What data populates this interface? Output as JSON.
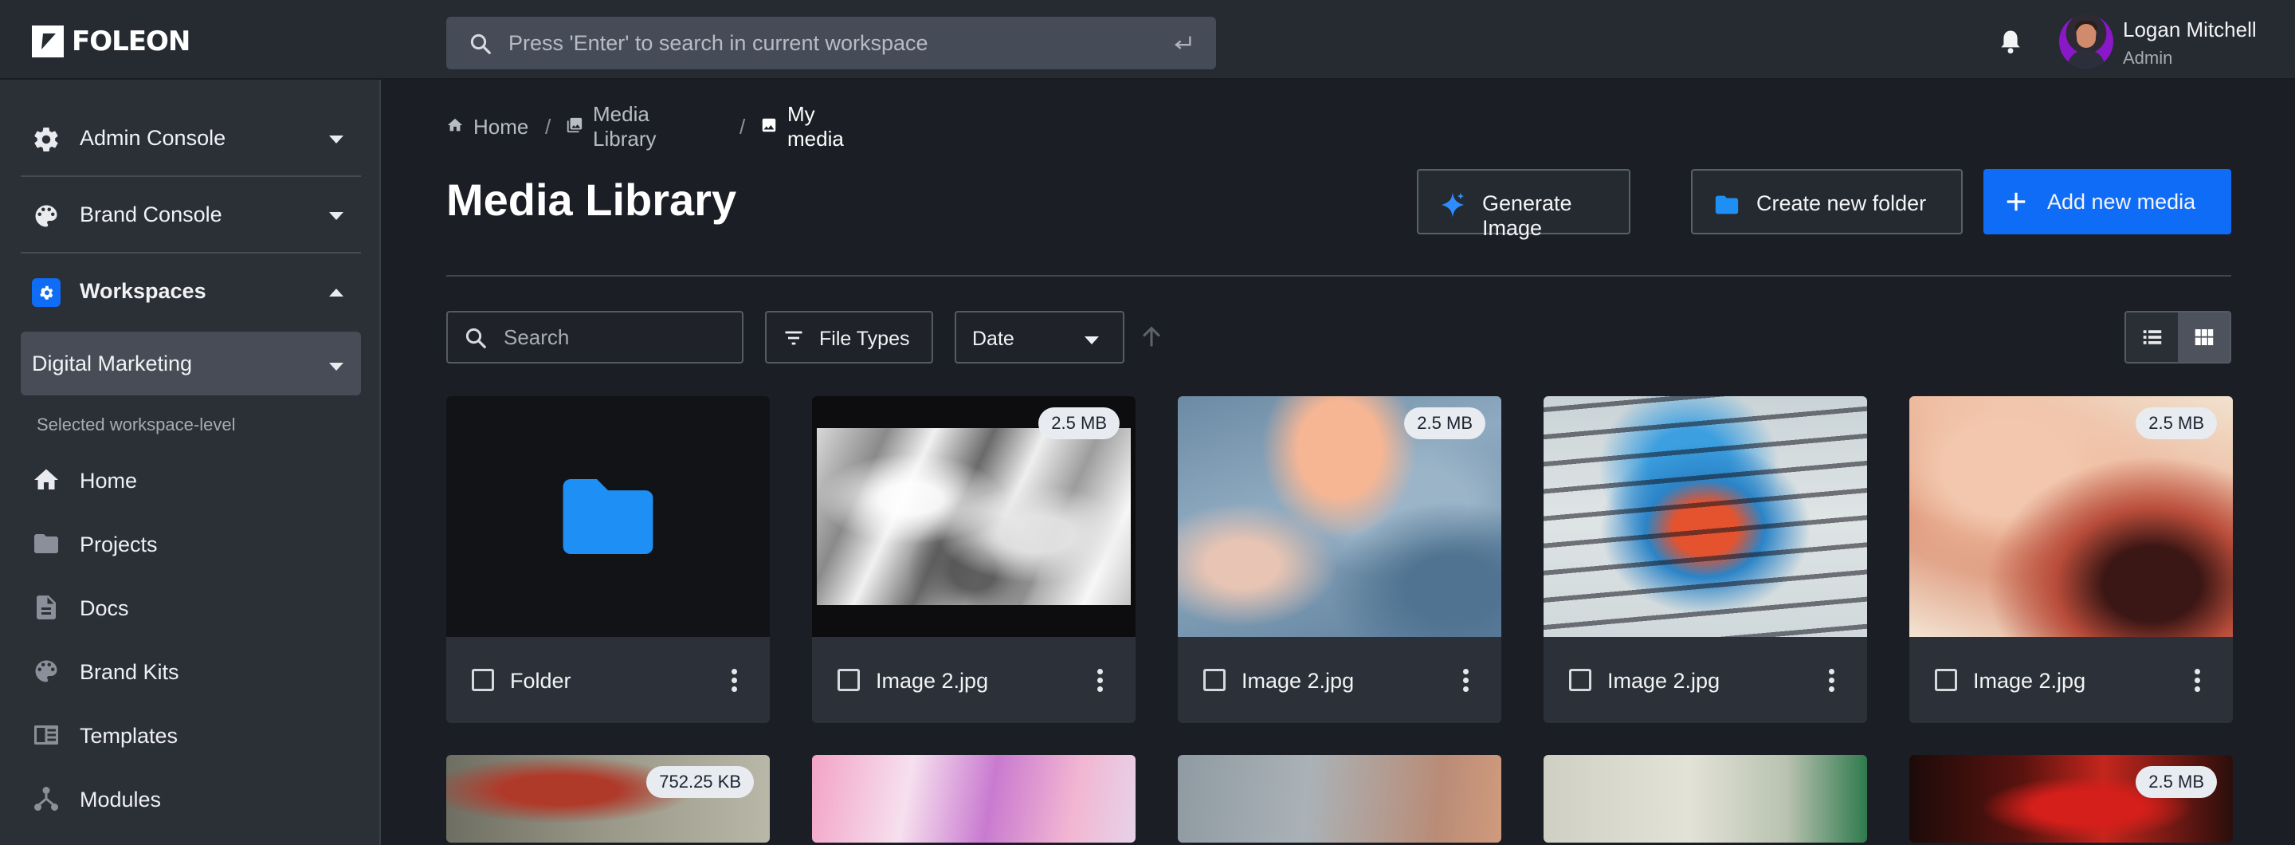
{
  "brand": {
    "name": "FOLEON"
  },
  "topbar": {
    "search_placeholder": "Press 'Enter' to search in current workspace",
    "user": {
      "name": "Logan Mitchell",
      "role": "Admin"
    }
  },
  "sidebar": {
    "sections": [
      {
        "label": "Admin Console",
        "icon": "gear-icon"
      },
      {
        "label": "Brand Console",
        "icon": "palette-icon"
      },
      {
        "label": "Workspaces",
        "icon": "workspace-icon"
      }
    ],
    "workspace": {
      "selected": "Digital Marketing",
      "note": "Selected workspace-level"
    },
    "nav": [
      {
        "label": "Home",
        "icon": "home-icon"
      },
      {
        "label": "Projects",
        "icon": "folder-icon"
      },
      {
        "label": "Docs",
        "icon": "document-icon"
      },
      {
        "label": "Brand Kits",
        "icon": "palette-icon"
      },
      {
        "label": "Templates",
        "icon": "template-icon"
      },
      {
        "label": "Modules",
        "icon": "modules-icon"
      }
    ]
  },
  "breadcrumb": [
    {
      "label": "Home",
      "icon": "home-icon"
    },
    {
      "label": "Media Library",
      "icon": "media-library-icon"
    },
    {
      "label": "My media",
      "icon": "image-icon"
    }
  ],
  "breadcrumb_separator": "/",
  "page": {
    "title": "Media Library",
    "actions": {
      "generate": "Generate Image",
      "create_folder": "Create new folder",
      "add_media": "Add new media"
    }
  },
  "filters": {
    "search_placeholder": "Search",
    "file_types": "File Types",
    "sort": "Date"
  },
  "colors": {
    "accent": "#0f6cf7",
    "folder": "#1e8ff5",
    "background": "#1b1f25",
    "sidebar": "#2b2f36"
  },
  "media": [
    {
      "name": "Folder",
      "type": "folder"
    },
    {
      "name": "Image 2.jpg",
      "size": "2.5 MB"
    },
    {
      "name": "Image 2.jpg",
      "size": "2.5 MB"
    },
    {
      "name": "Image 2.jpg",
      "size": ""
    },
    {
      "name": "Image 2.jpg",
      "size": "2.5 MB"
    },
    {
      "size": "752.25 KB"
    },
    {
      "size": ""
    },
    {
      "size": ""
    },
    {
      "size": ""
    },
    {
      "size": "2.5 MB"
    }
  ]
}
